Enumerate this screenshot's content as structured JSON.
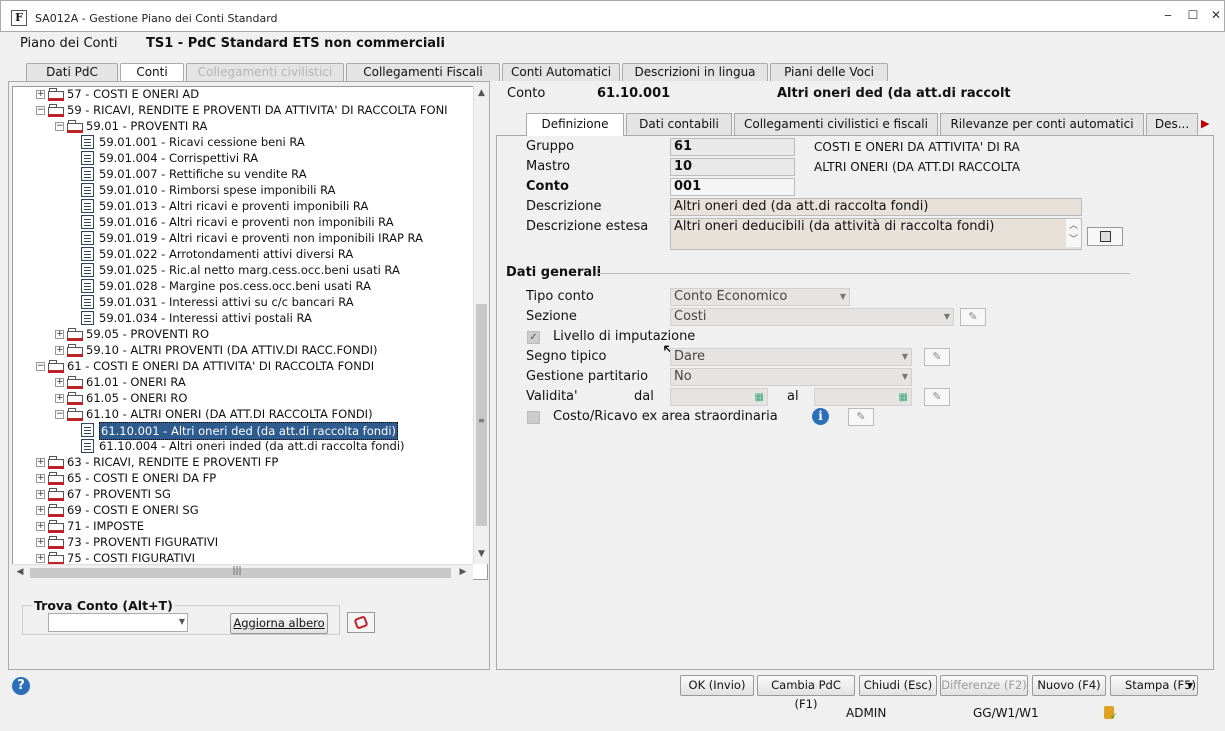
{
  "window": {
    "title": "SA012A - Gestione Piano dei Conti Standard",
    "minimize": "‒",
    "maximize": "☐",
    "close": "✕"
  },
  "header": {
    "label": "Piano dei Conti",
    "value": "TS1 - PdC Standard ETS non commerciali"
  },
  "top_tabs": [
    "Dati PdC",
    "Conti",
    "Collegamenti civilistici",
    "Collegamenti Fiscali",
    "Conti Automatici",
    "Descrizioni in lingua",
    "Piani delle Voci"
  ],
  "tree": {
    "nodes": [
      "57 - COSTI E ONERI AD",
      "59 - RICAVI, RENDITE E PROVENTI DA ATTIVITA' DI RACCOLTA FONI",
      "59.01 - PROVENTI RA",
      "59.01.001 - Ricavi cessione beni RA",
      "59.01.004 - Corrispettivi RA",
      "59.01.007 - Rettifiche su vendite RA",
      "59.01.010 - Rimborsi spese imponibili RA",
      "59.01.013 - Altri ricavi e proventi imponibili RA",
      "59.01.016 - Altri ricavi e proventi non imponibili RA",
      "59.01.019 - Altri ricavi e proventi non imponibili IRAP RA",
      "59.01.022 - Arrotondamenti attivi diversi RA",
      "59.01.025 - Ric.al netto marg.cess.occ.beni usati RA",
      "59.01.028 - Margine pos.cess.occ.beni usati RA",
      "59.01.031 - Interessi attivi su c/c bancari RA",
      "59.01.034 - Interessi attivi postali RA",
      "59.05 - PROVENTI RO",
      "59.10 - ALTRI PROVENTI (DA ATTIV.DI RACC.FONDI)",
      "61 - COSTI E ONERI DA ATTIVITA' DI RACCOLTA FONDI",
      "61.01 - ONERI RA",
      "61.05 - ONERI RO",
      "61.10 - ALTRI ONERI (DA ATT.DI RACCOLTA FONDI)",
      "61.10.001 - Altri oneri ded (da att.di raccolta fondi)",
      "61.10.004 - Altri oneri inded (da att.di raccolta fondi)",
      "63 - RICAVI, RENDITE E PROVENTI FP",
      "65 - COSTI E ONERI DA FP",
      "67 - PROVENTI SG",
      "69 - COSTI E ONERI SG",
      "71 - IMPOSTE",
      "73 - PROVENTI FIGURATIVI",
      "75 - COSTI FIGURATIVI"
    ]
  },
  "find": {
    "label": "Trova Conto (Alt+T)",
    "value": "",
    "refresh": "Aggiorna albero"
  },
  "account": {
    "label": "Conto",
    "code": "61.10.001",
    "desc": "Altri oneri ded (da att.di raccolt"
  },
  "right_tabs": [
    "Definizione",
    "Dati contabili",
    "Collegamenti civilistici e fiscali",
    "Rilevanze per conti automatici",
    "Des..."
  ],
  "form": {
    "gruppo_label": "Gruppo",
    "gruppo": "61",
    "gruppo_desc": "COSTI E ONERI DA ATTIVITA' DI RA",
    "mastro_label": "Mastro",
    "mastro": "10",
    "mastro_desc": "ALTRI ONERI (DA ATT.DI RACCOLTA",
    "conto_label": "Conto",
    "conto": "001",
    "descrizione_label": "Descrizione",
    "descrizione": "Altri oneri ded (da att.di raccolta fondi)",
    "estesa_label": "Descrizione estesa",
    "estesa": "Altri oneri deducibili (da attività di raccolta fondi)"
  },
  "general": {
    "section": "Dati generali",
    "tipo_label": "Tipo conto",
    "tipo": "Conto Economico",
    "sezione_label": "Sezione",
    "sezione": "Costi",
    "livello_label": "Livello di imputazione",
    "livello_check": "✓",
    "segno_label": "Segno tipico",
    "segno": "Dare",
    "gestione_label": "Gestione partitario",
    "gestione": "No",
    "validita_label": "Validita'",
    "dal": "dal",
    "al": "al",
    "straord_label": "Costo/Ricavo ex area straordinaria"
  },
  "buttons": [
    "OK (Invio)",
    "Cambia PdC (F1)",
    "Chiudi (Esc)",
    "Differenze (F2)",
    "Nuovo (F4)",
    "Stampa (F5)"
  ],
  "status": {
    "user": "ADMIN",
    "period": "GG/W1/W1"
  }
}
